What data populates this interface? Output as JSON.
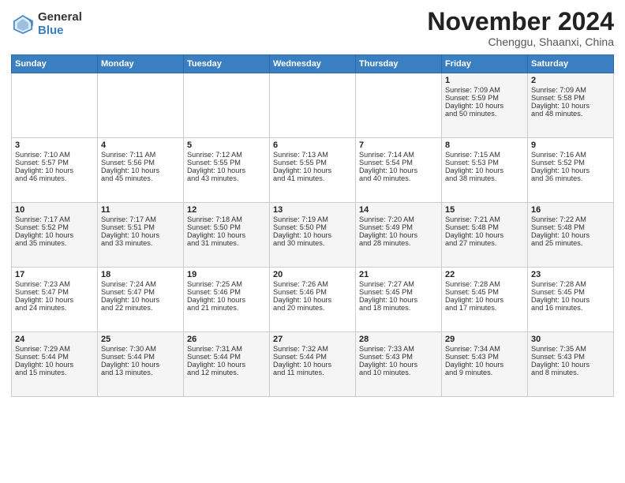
{
  "header": {
    "logo_general": "General",
    "logo_blue": "Blue",
    "month_title": "November 2024",
    "location": "Chenggu, Shaanxi, China"
  },
  "days_of_week": [
    "Sunday",
    "Monday",
    "Tuesday",
    "Wednesday",
    "Thursday",
    "Friday",
    "Saturday"
  ],
  "weeks": [
    [
      {
        "day": "",
        "info": ""
      },
      {
        "day": "",
        "info": ""
      },
      {
        "day": "",
        "info": ""
      },
      {
        "day": "",
        "info": ""
      },
      {
        "day": "",
        "info": ""
      },
      {
        "day": "1",
        "info": "Sunrise: 7:09 AM\nSunset: 5:59 PM\nDaylight: 10 hours\nand 50 minutes."
      },
      {
        "day": "2",
        "info": "Sunrise: 7:09 AM\nSunset: 5:58 PM\nDaylight: 10 hours\nand 48 minutes."
      }
    ],
    [
      {
        "day": "3",
        "info": "Sunrise: 7:10 AM\nSunset: 5:57 PM\nDaylight: 10 hours\nand 46 minutes."
      },
      {
        "day": "4",
        "info": "Sunrise: 7:11 AM\nSunset: 5:56 PM\nDaylight: 10 hours\nand 45 minutes."
      },
      {
        "day": "5",
        "info": "Sunrise: 7:12 AM\nSunset: 5:55 PM\nDaylight: 10 hours\nand 43 minutes."
      },
      {
        "day": "6",
        "info": "Sunrise: 7:13 AM\nSunset: 5:55 PM\nDaylight: 10 hours\nand 41 minutes."
      },
      {
        "day": "7",
        "info": "Sunrise: 7:14 AM\nSunset: 5:54 PM\nDaylight: 10 hours\nand 40 minutes."
      },
      {
        "day": "8",
        "info": "Sunrise: 7:15 AM\nSunset: 5:53 PM\nDaylight: 10 hours\nand 38 minutes."
      },
      {
        "day": "9",
        "info": "Sunrise: 7:16 AM\nSunset: 5:52 PM\nDaylight: 10 hours\nand 36 minutes."
      }
    ],
    [
      {
        "day": "10",
        "info": "Sunrise: 7:17 AM\nSunset: 5:52 PM\nDaylight: 10 hours\nand 35 minutes."
      },
      {
        "day": "11",
        "info": "Sunrise: 7:17 AM\nSunset: 5:51 PM\nDaylight: 10 hours\nand 33 minutes."
      },
      {
        "day": "12",
        "info": "Sunrise: 7:18 AM\nSunset: 5:50 PM\nDaylight: 10 hours\nand 31 minutes."
      },
      {
        "day": "13",
        "info": "Sunrise: 7:19 AM\nSunset: 5:50 PM\nDaylight: 10 hours\nand 30 minutes."
      },
      {
        "day": "14",
        "info": "Sunrise: 7:20 AM\nSunset: 5:49 PM\nDaylight: 10 hours\nand 28 minutes."
      },
      {
        "day": "15",
        "info": "Sunrise: 7:21 AM\nSunset: 5:48 PM\nDaylight: 10 hours\nand 27 minutes."
      },
      {
        "day": "16",
        "info": "Sunrise: 7:22 AM\nSunset: 5:48 PM\nDaylight: 10 hours\nand 25 minutes."
      }
    ],
    [
      {
        "day": "17",
        "info": "Sunrise: 7:23 AM\nSunset: 5:47 PM\nDaylight: 10 hours\nand 24 minutes."
      },
      {
        "day": "18",
        "info": "Sunrise: 7:24 AM\nSunset: 5:47 PM\nDaylight: 10 hours\nand 22 minutes."
      },
      {
        "day": "19",
        "info": "Sunrise: 7:25 AM\nSunset: 5:46 PM\nDaylight: 10 hours\nand 21 minutes."
      },
      {
        "day": "20",
        "info": "Sunrise: 7:26 AM\nSunset: 5:46 PM\nDaylight: 10 hours\nand 20 minutes."
      },
      {
        "day": "21",
        "info": "Sunrise: 7:27 AM\nSunset: 5:45 PM\nDaylight: 10 hours\nand 18 minutes."
      },
      {
        "day": "22",
        "info": "Sunrise: 7:28 AM\nSunset: 5:45 PM\nDaylight: 10 hours\nand 17 minutes."
      },
      {
        "day": "23",
        "info": "Sunrise: 7:28 AM\nSunset: 5:45 PM\nDaylight: 10 hours\nand 16 minutes."
      }
    ],
    [
      {
        "day": "24",
        "info": "Sunrise: 7:29 AM\nSunset: 5:44 PM\nDaylight: 10 hours\nand 15 minutes."
      },
      {
        "day": "25",
        "info": "Sunrise: 7:30 AM\nSunset: 5:44 PM\nDaylight: 10 hours\nand 13 minutes."
      },
      {
        "day": "26",
        "info": "Sunrise: 7:31 AM\nSunset: 5:44 PM\nDaylight: 10 hours\nand 12 minutes."
      },
      {
        "day": "27",
        "info": "Sunrise: 7:32 AM\nSunset: 5:44 PM\nDaylight: 10 hours\nand 11 minutes."
      },
      {
        "day": "28",
        "info": "Sunrise: 7:33 AM\nSunset: 5:43 PM\nDaylight: 10 hours\nand 10 minutes."
      },
      {
        "day": "29",
        "info": "Sunrise: 7:34 AM\nSunset: 5:43 PM\nDaylight: 10 hours\nand 9 minutes."
      },
      {
        "day": "30",
        "info": "Sunrise: 7:35 AM\nSunset: 5:43 PM\nDaylight: 10 hours\nand 8 minutes."
      }
    ]
  ]
}
